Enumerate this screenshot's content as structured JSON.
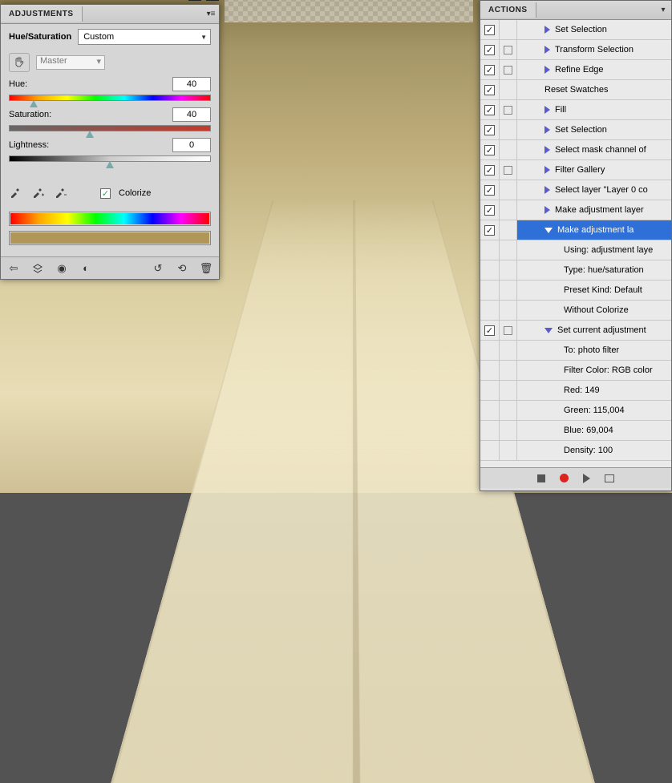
{
  "adjustments": {
    "tab_label": "ADJUSTMENTS",
    "title": "Hue/Saturation",
    "preset": "Custom",
    "channel": "Master",
    "hue": {
      "label": "Hue:",
      "value": "40",
      "pos": 12
    },
    "saturation": {
      "label": "Saturation:",
      "value": "40",
      "pos": 40
    },
    "lightness": {
      "label": "Lightness:",
      "value": "0",
      "pos": 50
    },
    "colorize_label": "Colorize",
    "colorize_checked": true,
    "icons": {
      "hand": "hand-icon",
      "eyedrop1": "eyedropper-icon",
      "eyedrop2": "eyedropper-plus-icon",
      "eyedrop3": "eyedropper-minus-icon",
      "back": "back-arrow-icon",
      "layers": "layers-icon",
      "eye": "eye-icon",
      "view": "view-icon",
      "ring": "reset-ring-icon",
      "reset": "reset-icon",
      "trash": "trash-icon"
    }
  },
  "actions": {
    "tab_label": "ACTIONS",
    "rows": [
      {
        "checked": true,
        "dialog": false,
        "disclose": "closed",
        "indent": 1,
        "label": "Set Selection"
      },
      {
        "checked": true,
        "dialog": true,
        "disclose": "closed",
        "indent": 1,
        "label": "Transform Selection"
      },
      {
        "checked": true,
        "dialog": true,
        "disclose": "closed",
        "indent": 1,
        "label": "Refine Edge"
      },
      {
        "checked": true,
        "dialog": false,
        "disclose": "none",
        "indent": 1,
        "label": "Reset Swatches"
      },
      {
        "checked": true,
        "dialog": true,
        "disclose": "closed",
        "indent": 1,
        "label": "Fill"
      },
      {
        "checked": true,
        "dialog": false,
        "disclose": "closed",
        "indent": 1,
        "label": "Set Selection"
      },
      {
        "checked": true,
        "dialog": false,
        "disclose": "closed",
        "indent": 1,
        "label": "Select mask channel of"
      },
      {
        "checked": true,
        "dialog": true,
        "disclose": "closed",
        "indent": 1,
        "label": "Filter Gallery"
      },
      {
        "checked": true,
        "dialog": false,
        "disclose": "closed",
        "indent": 1,
        "label": "Select layer \"Layer 0 co"
      },
      {
        "checked": true,
        "dialog": false,
        "disclose": "closed",
        "indent": 1,
        "label": "Make adjustment layer"
      },
      {
        "checked": true,
        "dialog": false,
        "disclose": "open",
        "indent": 1,
        "label": "Make adjustment la",
        "selected": true
      },
      {
        "checked": null,
        "dialog": null,
        "disclose": "none",
        "indent": 2,
        "label": "Using: adjustment laye"
      },
      {
        "checked": null,
        "dialog": null,
        "disclose": "none",
        "indent": 2,
        "label": "Type: hue/saturation"
      },
      {
        "checked": null,
        "dialog": null,
        "disclose": "none",
        "indent": 2,
        "label": "Preset Kind: Default"
      },
      {
        "checked": null,
        "dialog": null,
        "disclose": "none",
        "indent": 2,
        "label": "Without Colorize"
      },
      {
        "checked": true,
        "dialog": true,
        "disclose": "open",
        "indent": 1,
        "label": "Set current adjustment"
      },
      {
        "checked": null,
        "dialog": null,
        "disclose": "none",
        "indent": 2,
        "label": "To: photo filter"
      },
      {
        "checked": null,
        "dialog": null,
        "disclose": "none",
        "indent": 2,
        "label": "Filter Color: RGB color"
      },
      {
        "checked": null,
        "dialog": null,
        "disclose": "none",
        "indent": 2,
        "label": "Red: 149"
      },
      {
        "checked": null,
        "dialog": null,
        "disclose": "none",
        "indent": 2,
        "label": "Green: 115,004"
      },
      {
        "checked": null,
        "dialog": null,
        "disclose": "none",
        "indent": 2,
        "label": "Blue: 69,004"
      },
      {
        "checked": null,
        "dialog": null,
        "disclose": "none",
        "indent": 2,
        "label": "Density: 100"
      }
    ],
    "footer_icons": {
      "stop": "stop-icon",
      "record": "record-icon",
      "play": "play-icon",
      "folder": "new-set-icon"
    }
  }
}
